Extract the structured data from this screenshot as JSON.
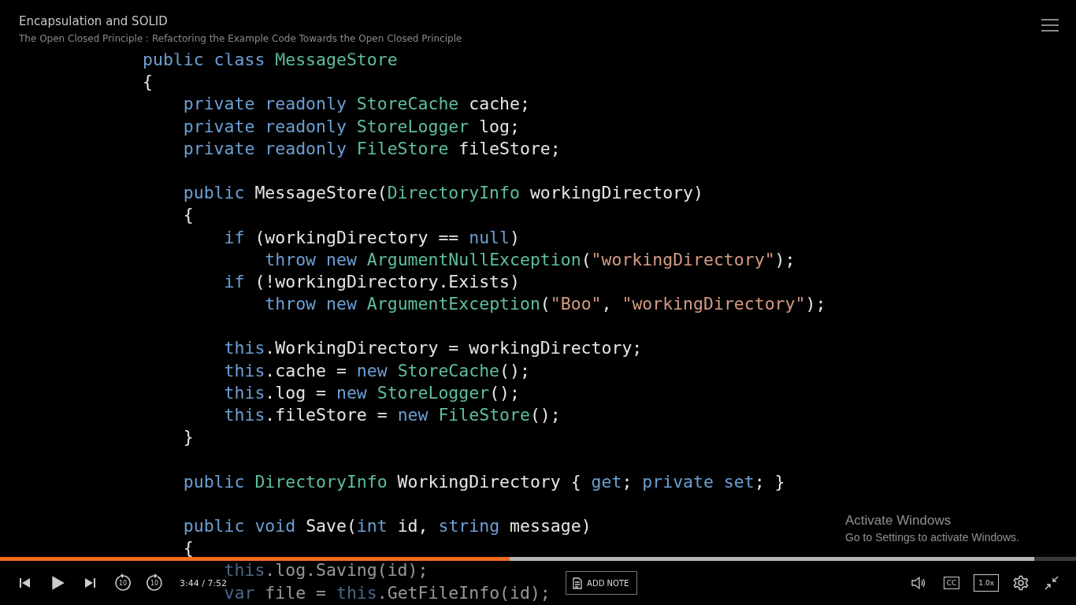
{
  "header": {
    "course_title": "Encapsulation and SOLID",
    "clip_title": "The Open Closed Principle : Refactoring the Example Code Towards the Open Closed Principle"
  },
  "code": [
    {
      "segments": [
        {
          "kind": "kw",
          "text": "public class "
        },
        {
          "kind": "type",
          "text": "MessageStore"
        }
      ]
    },
    {
      "segments": [
        {
          "kind": "plain",
          "text": "{"
        }
      ]
    },
    {
      "segments": [
        {
          "kind": "kw",
          "text": "    private readonly "
        },
        {
          "kind": "type",
          "text": "StoreCache"
        },
        {
          "kind": "plain",
          "text": " cache;"
        }
      ]
    },
    {
      "segments": [
        {
          "kind": "kw",
          "text": "    private readonly "
        },
        {
          "kind": "type",
          "text": "StoreLogger"
        },
        {
          "kind": "plain",
          "text": " log;"
        }
      ]
    },
    {
      "segments": [
        {
          "kind": "kw",
          "text": "    private readonly "
        },
        {
          "kind": "type",
          "text": "FileStore"
        },
        {
          "kind": "plain",
          "text": " fileStore;"
        }
      ]
    },
    {
      "kind": "blank"
    },
    {
      "segments": [
        {
          "kind": "kw",
          "text": "    public "
        },
        {
          "kind": "plain",
          "text": "MessageStore("
        },
        {
          "kind": "type",
          "text": "DirectoryInfo"
        },
        {
          "kind": "plain",
          "text": " workingDirectory)"
        }
      ]
    },
    {
      "segments": [
        {
          "kind": "plain",
          "text": "    {"
        }
      ]
    },
    {
      "segments": [
        {
          "kind": "kw",
          "text": "        if"
        },
        {
          "kind": "plain",
          "text": " (workingDirectory == "
        },
        {
          "kind": "kw",
          "text": "null"
        },
        {
          "kind": "plain",
          "text": ")"
        }
      ]
    },
    {
      "segments": [
        {
          "kind": "kw",
          "text": "            throw new "
        },
        {
          "kind": "type",
          "text": "ArgumentNullException"
        },
        {
          "kind": "plain",
          "text": "("
        },
        {
          "kind": "str",
          "text": "\"workingDirectory\""
        },
        {
          "kind": "plain",
          "text": ");"
        }
      ]
    },
    {
      "segments": [
        {
          "kind": "kw",
          "text": "        if"
        },
        {
          "kind": "plain",
          "text": " (!workingDirectory.Exists)"
        }
      ]
    },
    {
      "segments": [
        {
          "kind": "kw",
          "text": "            throw new "
        },
        {
          "kind": "type",
          "text": "ArgumentException"
        },
        {
          "kind": "plain",
          "text": "("
        },
        {
          "kind": "str",
          "text": "\"Boo\""
        },
        {
          "kind": "plain",
          "text": ", "
        },
        {
          "kind": "str",
          "text": "\"workingDirectory\""
        },
        {
          "kind": "plain",
          "text": ");"
        }
      ]
    },
    {
      "kind": "blank"
    },
    {
      "segments": [
        {
          "kind": "kw",
          "text": "        this"
        },
        {
          "kind": "plain",
          "text": ".WorkingDirectory = workingDirectory;"
        }
      ]
    },
    {
      "segments": [
        {
          "kind": "kw",
          "text": "        this"
        },
        {
          "kind": "plain",
          "text": ".cache = "
        },
        {
          "kind": "kw",
          "text": "new "
        },
        {
          "kind": "type",
          "text": "StoreCache"
        },
        {
          "kind": "plain",
          "text": "();"
        }
      ]
    },
    {
      "segments": [
        {
          "kind": "kw",
          "text": "        this"
        },
        {
          "kind": "plain",
          "text": ".log = "
        },
        {
          "kind": "kw",
          "text": "new "
        },
        {
          "kind": "type",
          "text": "StoreLogger"
        },
        {
          "kind": "plain",
          "text": "();"
        }
      ]
    },
    {
      "segments": [
        {
          "kind": "kw",
          "text": "        this"
        },
        {
          "kind": "plain",
          "text": ".fileStore = "
        },
        {
          "kind": "kw",
          "text": "new "
        },
        {
          "kind": "type",
          "text": "FileStore"
        },
        {
          "kind": "plain",
          "text": "();"
        }
      ]
    },
    {
      "segments": [
        {
          "kind": "plain",
          "text": "    }"
        }
      ]
    },
    {
      "kind": "blank"
    },
    {
      "segments": [
        {
          "kind": "kw",
          "text": "    public "
        },
        {
          "kind": "type",
          "text": "DirectoryInfo"
        },
        {
          "kind": "plain",
          "text": " WorkingDirectory { "
        },
        {
          "kind": "kw",
          "text": "get"
        },
        {
          "kind": "plain",
          "text": "; "
        },
        {
          "kind": "kw",
          "text": "private set"
        },
        {
          "kind": "plain",
          "text": "; }"
        }
      ]
    },
    {
      "kind": "blank"
    },
    {
      "segments": [
        {
          "kind": "kw",
          "text": "    public void "
        },
        {
          "kind": "plain",
          "text": "Save("
        },
        {
          "kind": "kw",
          "text": "int"
        },
        {
          "kind": "plain",
          "text": " id, "
        },
        {
          "kind": "kw",
          "text": "string"
        },
        {
          "kind": "plain",
          "text": " message)"
        }
      ]
    },
    {
      "segments": [
        {
          "kind": "plain",
          "text": "    {"
        }
      ]
    },
    {
      "segments": [
        {
          "kind": "kw",
          "text": "        this"
        },
        {
          "kind": "plain",
          "text": ".log.Saving(id);"
        }
      ]
    },
    {
      "segments": [
        {
          "kind": "kw",
          "text": "        var"
        },
        {
          "kind": "plain",
          "text": " file = "
        },
        {
          "kind": "kw",
          "text": "this"
        },
        {
          "kind": "plain",
          "text": ".GetFileInfo(id);"
        }
      ]
    }
  ],
  "activation_notice": {
    "title": "Activate Windows",
    "message": "Go to Settings to activate Windows."
  },
  "progress": {
    "level": 0.474
  },
  "buffered": {
    "level": 0.961
  },
  "controls": {
    "rewind_label": "10",
    "forward_label": "10",
    "time": "3:44 / 7:52",
    "add_note": "ADD NOTE",
    "captions": "CC",
    "speed": "1.0x"
  }
}
